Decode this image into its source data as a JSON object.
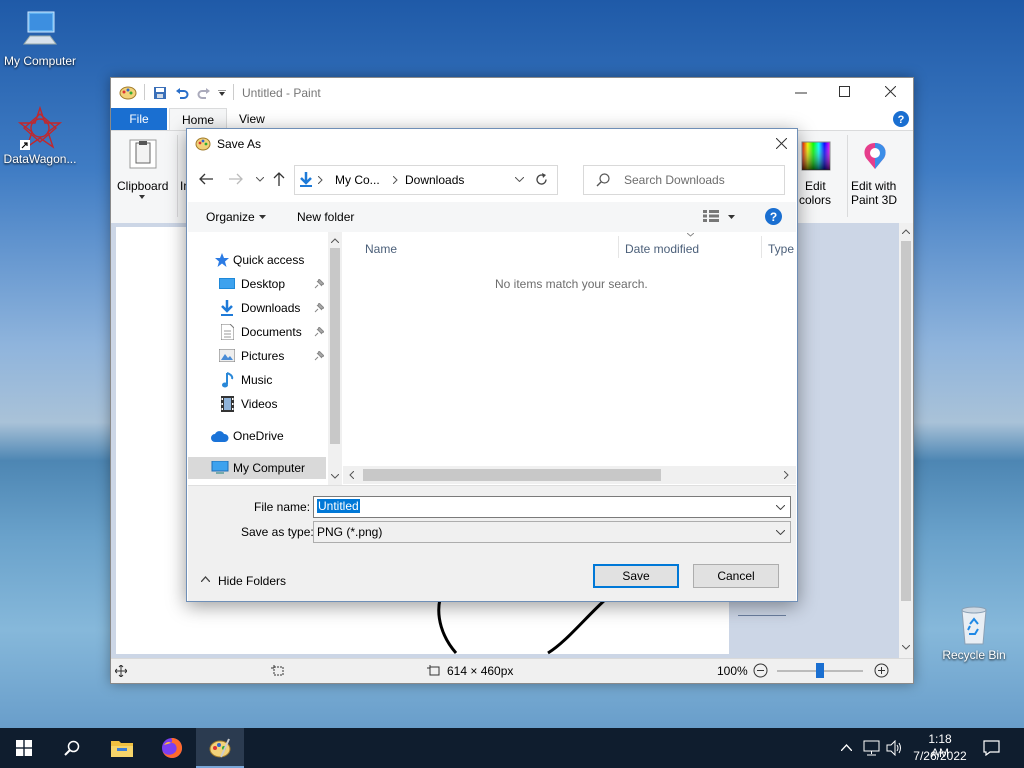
{
  "desktop": {
    "icons": [
      {
        "label": "My Computer"
      },
      {
        "label": "DataWagon..."
      },
      {
        "label": "Recycle Bin"
      }
    ]
  },
  "paint": {
    "title": "Untitled - Paint",
    "tabs": [
      "File",
      "Home",
      "View"
    ],
    "ribbon": {
      "clipboard": "Clipboard",
      "im": "Im",
      "edit_colors": [
        "Edit",
        "colors"
      ],
      "edit_paint3d": [
        "Edit with",
        "Paint 3D"
      ]
    },
    "status": {
      "size": "614 × 460px",
      "zoom": "100%"
    }
  },
  "dialog": {
    "title": "Save As",
    "breadcrumb": [
      "My Co...",
      "Downloads"
    ],
    "search_placeholder": "Search Downloads",
    "organize": "Organize",
    "new_folder": "New folder",
    "nav": {
      "quick_access": "Quick access",
      "items": [
        "Desktop",
        "Downloads",
        "Documents",
        "Pictures",
        "Music",
        "Videos"
      ],
      "onedrive": "OneDrive",
      "mycomputer": "My Computer"
    },
    "columns": [
      "Name",
      "Date modified",
      "Type"
    ],
    "empty_message": "No items match your search.",
    "filename_label": "File name:",
    "filename_value": "Untitled",
    "type_label": "Save as type:",
    "type_value": "PNG (*.png)",
    "hide_folders": "Hide Folders",
    "save": "Save",
    "cancel": "Cancel"
  },
  "taskbar": {
    "time": "1:18 AM",
    "date": "7/26/2022"
  },
  "colors": {
    "accent": "#0078d7",
    "file_tab": "#1a6fd1",
    "taskbar": "#0f1d2e"
  }
}
